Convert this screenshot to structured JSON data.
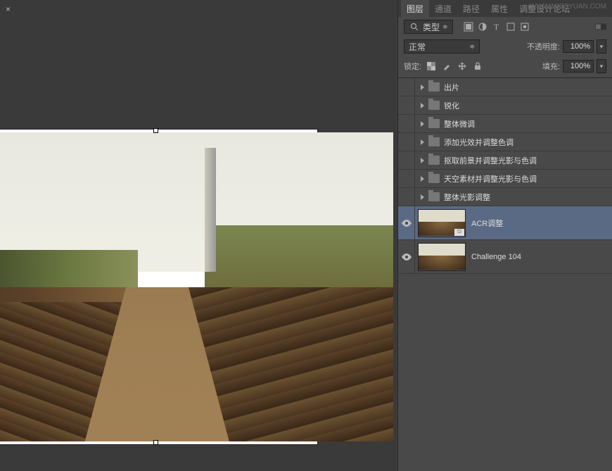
{
  "canvas": {
    "close": "×"
  },
  "watermark": "WWW.MISSYUAN.COM",
  "tabs": {
    "layers": "图层",
    "channels": "通道",
    "paths": "路径",
    "properties": "属性",
    "extra": "调整设计论坛"
  },
  "filter": {
    "kind": "类型"
  },
  "blend": {
    "mode": "正常",
    "opacity_label": "不透明度:",
    "opacity_value": "100%"
  },
  "lock": {
    "label": "锁定:",
    "fill_label": "填充:",
    "fill_value": "100%"
  },
  "layers": {
    "groups": [
      {
        "name": "出片"
      },
      {
        "name": "锐化"
      },
      {
        "name": "整体微调"
      },
      {
        "name": "添加光效并调整色调"
      },
      {
        "name": "抠取前景并调整光影与色调"
      },
      {
        "name": "天空素材并调整光影与色调"
      },
      {
        "name": "整体光影调整"
      }
    ],
    "image_layers": [
      {
        "name": "ACR调整",
        "selected": true
      },
      {
        "name": "Challenge 104",
        "selected": false
      }
    ]
  }
}
